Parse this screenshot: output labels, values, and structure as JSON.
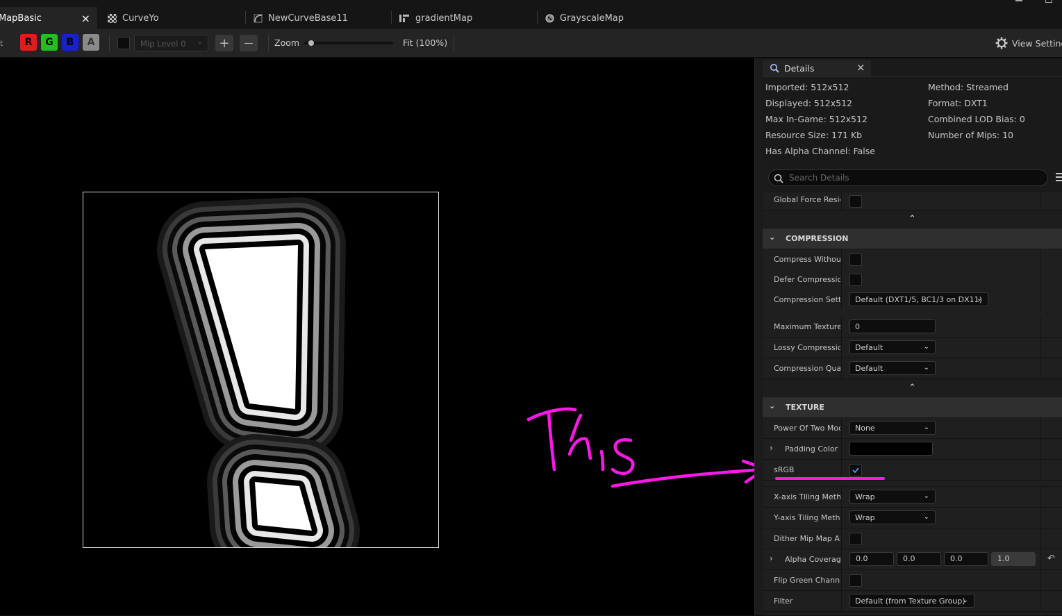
{
  "tabs": [
    {
      "label": "MapBasic",
      "active": true,
      "close": "×"
    },
    {
      "label": "CurveYo",
      "icon": "checker-icon"
    },
    {
      "label": "NewCurveBase11",
      "icon": "curve-icon"
    },
    {
      "label": "gradientMap",
      "icon": "gradient-icon"
    },
    {
      "label": "GrayscaleMap",
      "icon": "texture-icon"
    }
  ],
  "toolbar": {
    "channels": [
      {
        "label": "R",
        "color": "#e01c1c"
      },
      {
        "label": "G",
        "color": "#20c020"
      },
      {
        "label": "B",
        "color": "#1820d0"
      },
      {
        "label": "A",
        "color": "#8a8a8a"
      }
    ],
    "mip_level": "Mip Level 0",
    "plus": "+",
    "minus": "—",
    "zoom_label": "Zoom",
    "zoom_value": "Fit (100%)",
    "view_settings": "View Setting"
  },
  "annotation": {
    "text": "This",
    "color": "#ff19e8"
  },
  "details": {
    "title": "Details",
    "close": "×",
    "info_left": [
      "Imported: 512x512",
      "Displayed: 512x512",
      "Max In-Game: 512x512",
      "Resource Size: 171 Kb",
      "Has Alpha Channel: False"
    ],
    "info_right": [
      "Method: Streamed",
      "Format: DXT1",
      "Combined LOD Bias: 0",
      "Number of Mips: 10"
    ],
    "search_placeholder": "Search Details",
    "rows_top": {
      "global_force": "Global Force Reside"
    },
    "compression": {
      "header": "COMPRESSION",
      "compress_without": "Compress Without",
      "defer_compression": "Defer Compression",
      "compression_settings": "Compression Settir",
      "compression_settings_value": "Default (DXT1/5, BC1/3 on DX11)",
      "maximum_texture": "Maximum Texture",
      "maximum_texture_value": "0",
      "lossy_compression": "Lossy Compression",
      "lossy_compression_value": "Default",
      "compression_quality": "Compression Quali",
      "compression_quality_value": "Default"
    },
    "texture": {
      "header": "TEXTURE",
      "power_of_two": "Power Of Two Mod",
      "power_of_two_value": "None",
      "padding_color": "Padding Color",
      "srgb": "sRGB",
      "x_tiling": "X-axis Tiling Metho",
      "x_tiling_value": "Wrap",
      "y_tiling": "Y-axis Tiling Metho",
      "y_tiling_value": "Wrap",
      "dither_mip": "Dither Mip Map Alp",
      "alpha_coverage": "Alpha Coverage",
      "alpha_values": [
        "0.0",
        "0.0",
        "0.0",
        "1.0"
      ],
      "flip_green": "Flip Green Channel",
      "filter": "Filter",
      "filter_value": "Default (from Texture Group)"
    }
  }
}
